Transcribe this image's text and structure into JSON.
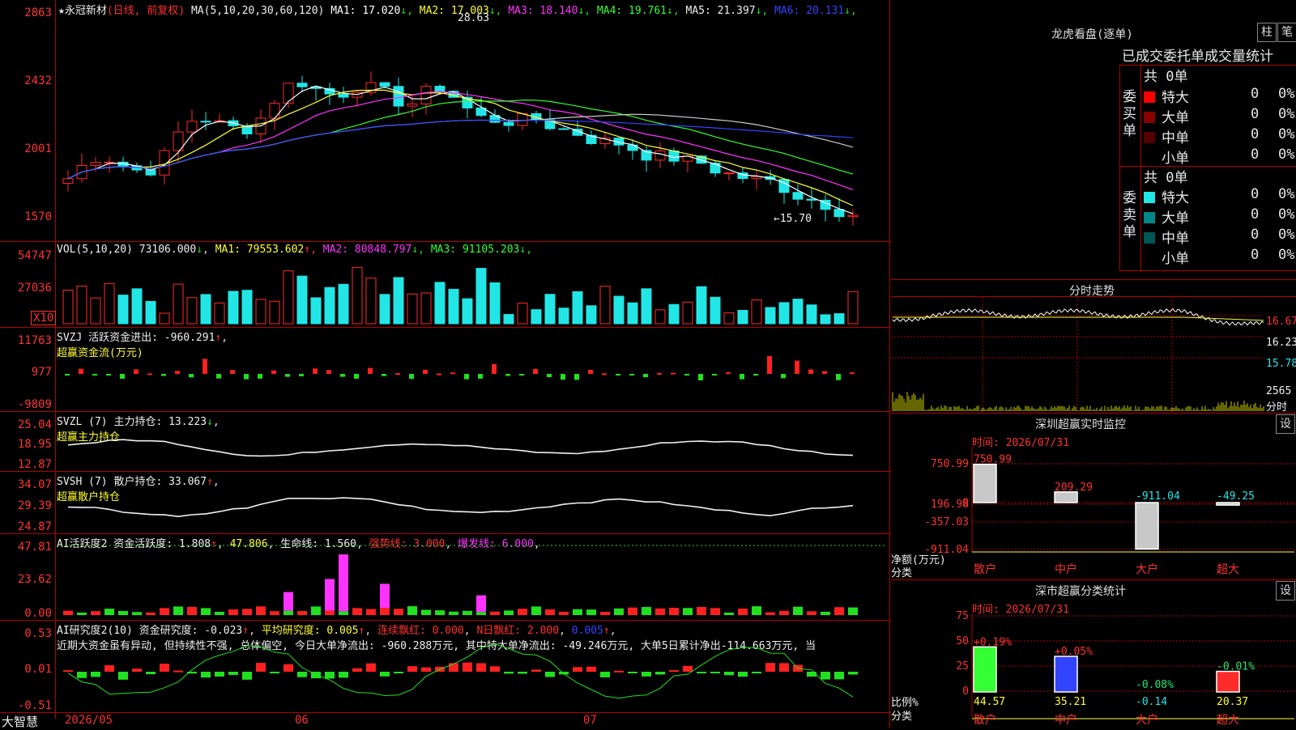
{
  "stock": {
    "star": "★",
    "name": "永冠新材",
    "mode": "(日线, 前复权)",
    "ma_label": "MA(5,10,20,30,60,120)"
  },
  "colors": {
    "up": "#ff2a2a",
    "down": "#22e6e6",
    "grid": "#b30000"
  },
  "main": {
    "ma_values": [
      {
        "label": "MA1: 17.020",
        "arrow": "↓",
        "color": "#ffffff"
      },
      {
        "label": "MA2: 17.003",
        "arrow": "↓",
        "color": "#ffff33"
      },
      {
        "label": "MA3: 18.140",
        "arrow": "↓",
        "color": "#ff33ff"
      },
      {
        "label": "MA4: 19.761",
        "arrow": "↓",
        "color": "#33ff33"
      },
      {
        "label": "MA5: 21.397",
        "arrow": "↓",
        "color": "#f0f0f0"
      },
      {
        "label": "MA6: 20.131",
        "arrow": "↓",
        "color": "#3344ff"
      }
    ],
    "y_labels": [
      "2863",
      "2432",
      "2001",
      "1570"
    ],
    "high_mark": "28.63",
    "low_mark": "←15.70"
  },
  "vol": {
    "title": "VOL(5,10,20)",
    "value": "73106.000",
    "arrow": "↓",
    "mas": [
      {
        "label": "MA1: 79553.602",
        "arrow": "↑",
        "color": "#ffff33"
      },
      {
        "label": "MA2: 80848.797",
        "arrow": "↓",
        "color": "#ff33ff"
      },
      {
        "label": "MA3: 91105.203",
        "arrow": "↓",
        "color": "#33ff33"
      }
    ],
    "y_labels": [
      "54747",
      "27036"
    ],
    "unit": "X10"
  },
  "svzj": {
    "line1": "SVZJ  活跃资金进出: -960.291",
    "arrow": "↑",
    "line2": "超赢资金流(万元)",
    "y_labels": [
      "11763",
      "977",
      "-9809"
    ]
  },
  "svzl": {
    "line1": "SVZL (7) 主力持仓: 13.223",
    "arrow": "↓",
    "line2": "超赢主力持仓",
    "y_labels": [
      "25.04",
      "18.95",
      "12.87"
    ]
  },
  "svsh": {
    "line1": "SVSH (7) 散户持仓: 33.067",
    "arrow": "↑",
    "line2": "超赢散户持仓",
    "y_labels": [
      "34.07",
      "29.39",
      "24.87"
    ]
  },
  "ai1": {
    "prefix": "AI活跃度2 资金活跃度: 1.808",
    "v1": "47.806",
    "v2": "生命线: 1.560",
    "v3": "强势线: 3.000",
    "v4": "爆发线: 6.000",
    "y_labels": [
      "47.81",
      "23.62",
      "0.00"
    ]
  },
  "ai2": {
    "prefix": "AI研究度2(10) 资金研究度: -0.023",
    "v1": "平均研究度: 0.005",
    "v2": "连续飘红: 0.000",
    "v3": "N日飘红: 2.000",
    "v4": "0.005",
    "text": "近期大资金虽有异动, 但持续性不强, 总体偏空, 今日大单净流出: -960.288万元, 其中特大单净流出: -49.246万元, 大单5日累计净出-114.663万元, 当",
    "y_labels": [
      "0.53",
      "0.01",
      "-0.51"
    ]
  },
  "xaxis": {
    "brand": "大智慧",
    "labels": [
      "2026/05",
      "06",
      "07"
    ]
  },
  "dragon": {
    "title": "龙虎看盘(逐单)",
    "btn1": "柱",
    "btn2": "笔",
    "header": "已成交委托单成交量统计",
    "buy": {
      "label": "委\n买\n单",
      "total": "共 0单",
      "rows": [
        {
          "name": "特大",
          "val": "0",
          "pct": "0%",
          "color": "#ff0000"
        },
        {
          "name": "大单",
          "val": "0",
          "pct": "0%",
          "color": "#880000"
        },
        {
          "name": "中单",
          "val": "0",
          "pct": "0%",
          "color": "#550000"
        },
        {
          "name": "小单",
          "val": "0",
          "pct": "0%",
          "color": "#000000"
        }
      ]
    },
    "sell": {
      "label": "委\n卖\n单",
      "total": "共 0单",
      "rows": [
        {
          "name": "特大",
          "val": "0",
          "pct": "0%",
          "color": "#22e6e6"
        },
        {
          "name": "大单",
          "val": "0",
          "pct": "0%",
          "color": "#008888"
        },
        {
          "name": "中单",
          "val": "0",
          "pct": "0%",
          "color": "#005555"
        },
        {
          "name": "小单",
          "val": "0",
          "pct": "0%",
          "color": "#000000"
        }
      ]
    }
  },
  "intraday": {
    "title": "分时走势",
    "y_labels": [
      "16.67",
      "16.23",
      "15.78",
      "2565"
    ],
    "foot": "分时"
  },
  "monitor": {
    "title": "深圳超赢实时监控",
    "btn": "设",
    "time": "时间: 2026/07/31",
    "y_labels": [
      "750.99",
      "196.98",
      "0",
      "-357.03",
      "-911.04"
    ],
    "axis_label": "净额(万元)",
    "axis_label2": "分类",
    "bars": [
      {
        "cat": "散户",
        "value": 750.99,
        "label": "750.99"
      },
      {
        "cat": "中户",
        "value": 209.29,
        "label": "209.29"
      },
      {
        "cat": "大户",
        "value": -911.04,
        "label": "-911.04"
      },
      {
        "cat": "超大",
        "value": -49.25,
        "label": "-49.25"
      }
    ]
  },
  "classify": {
    "title": "深市超赢分类统计",
    "btn": "设",
    "time": "时间: 2026/07/31",
    "y_labels": [
      "75",
      "50",
      "25",
      "0"
    ],
    "axis_label": "比例%",
    "axis_label2": "分类",
    "bars": [
      {
        "cat": "散户",
        "value": 44.57,
        "label": "44.57",
        "delta": "+0.19%"
      },
      {
        "cat": "中户",
        "value": 35.21,
        "label": "35.21",
        "delta": "+0.05%"
      },
      {
        "cat": "大户",
        "value": -0.14,
        "label": "-0.14",
        "delta": "-0.08%"
      },
      {
        "cat": "超大",
        "value": 20.37,
        "label": "20.37",
        "delta": "-0.01%"
      }
    ]
  }
}
